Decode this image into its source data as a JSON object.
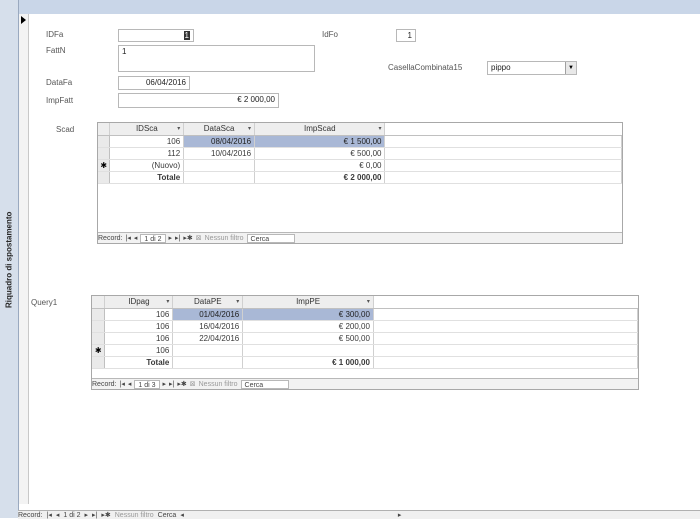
{
  "nav_pane": {
    "label": "Riquadro di spostamento"
  },
  "form": {
    "idfa_label": "IDFa",
    "idfa_value": "1",
    "idfo_label": "IdFo",
    "idfo_value": "1",
    "fattn_label": "FattN",
    "fattn_value": "1",
    "casella_label": "CasellaCombinata15",
    "casella_value": "pippo",
    "datafa_label": "DataFa",
    "datafa_value": "06/04/2016",
    "impfatt_label": "ImpFatt",
    "impfatt_value": "€ 2 000,00"
  },
  "scad": {
    "label": "Scad",
    "headers": [
      "IDSca",
      "DataSca",
      "ImpScad"
    ],
    "rows": [
      [
        "106",
        "08/04/2016",
        "€ 1 500,00"
      ],
      [
        "112",
        "10/04/2016",
        "€ 500,00"
      ],
      [
        "(Nuovo)",
        "",
        "€ 0,00"
      ]
    ],
    "new_marker": "✱",
    "total_label": "Totale",
    "total_value": "€ 2 000,00",
    "nav": {
      "record_label": "Record:",
      "first": "|◂",
      "prev": "◂",
      "position": "1 di 2",
      "next": "▸",
      "last": "▸|",
      "new": "▸✱",
      "filter": "Nessun filtro",
      "search": "Cerca"
    }
  },
  "query1": {
    "label": "Query1",
    "headers": [
      "IDpag",
      "DataPE",
      "ImpPE"
    ],
    "rows": [
      [
        "106",
        "01/04/2016",
        "€ 300,00"
      ],
      [
        "106",
        "16/04/2016",
        "€ 200,00"
      ],
      [
        "106",
        "22/04/2016",
        "€ 500,00"
      ],
      [
        "106",
        "",
        ""
      ]
    ],
    "new_marker": "✱",
    "total_label": "Totale",
    "total_value": "€ 1 000,00",
    "nav": {
      "record_label": "Record:",
      "first": "|◂",
      "prev": "◂",
      "position": "1 di 3",
      "next": "▸",
      "last": "▸|",
      "new": "▸✱",
      "filter": "Nessun filtro",
      "search": "Cerca"
    }
  },
  "main_nav": {
    "record_label": "Record:",
    "first": "|◂",
    "prev": "◂",
    "position": "1 di 2",
    "next": "▸",
    "last": "▸|",
    "new": "▸✱",
    "filter": "Nessun filtro",
    "search": "Cerca",
    "scroll_left": "◂",
    "scroll_right": "▸"
  }
}
